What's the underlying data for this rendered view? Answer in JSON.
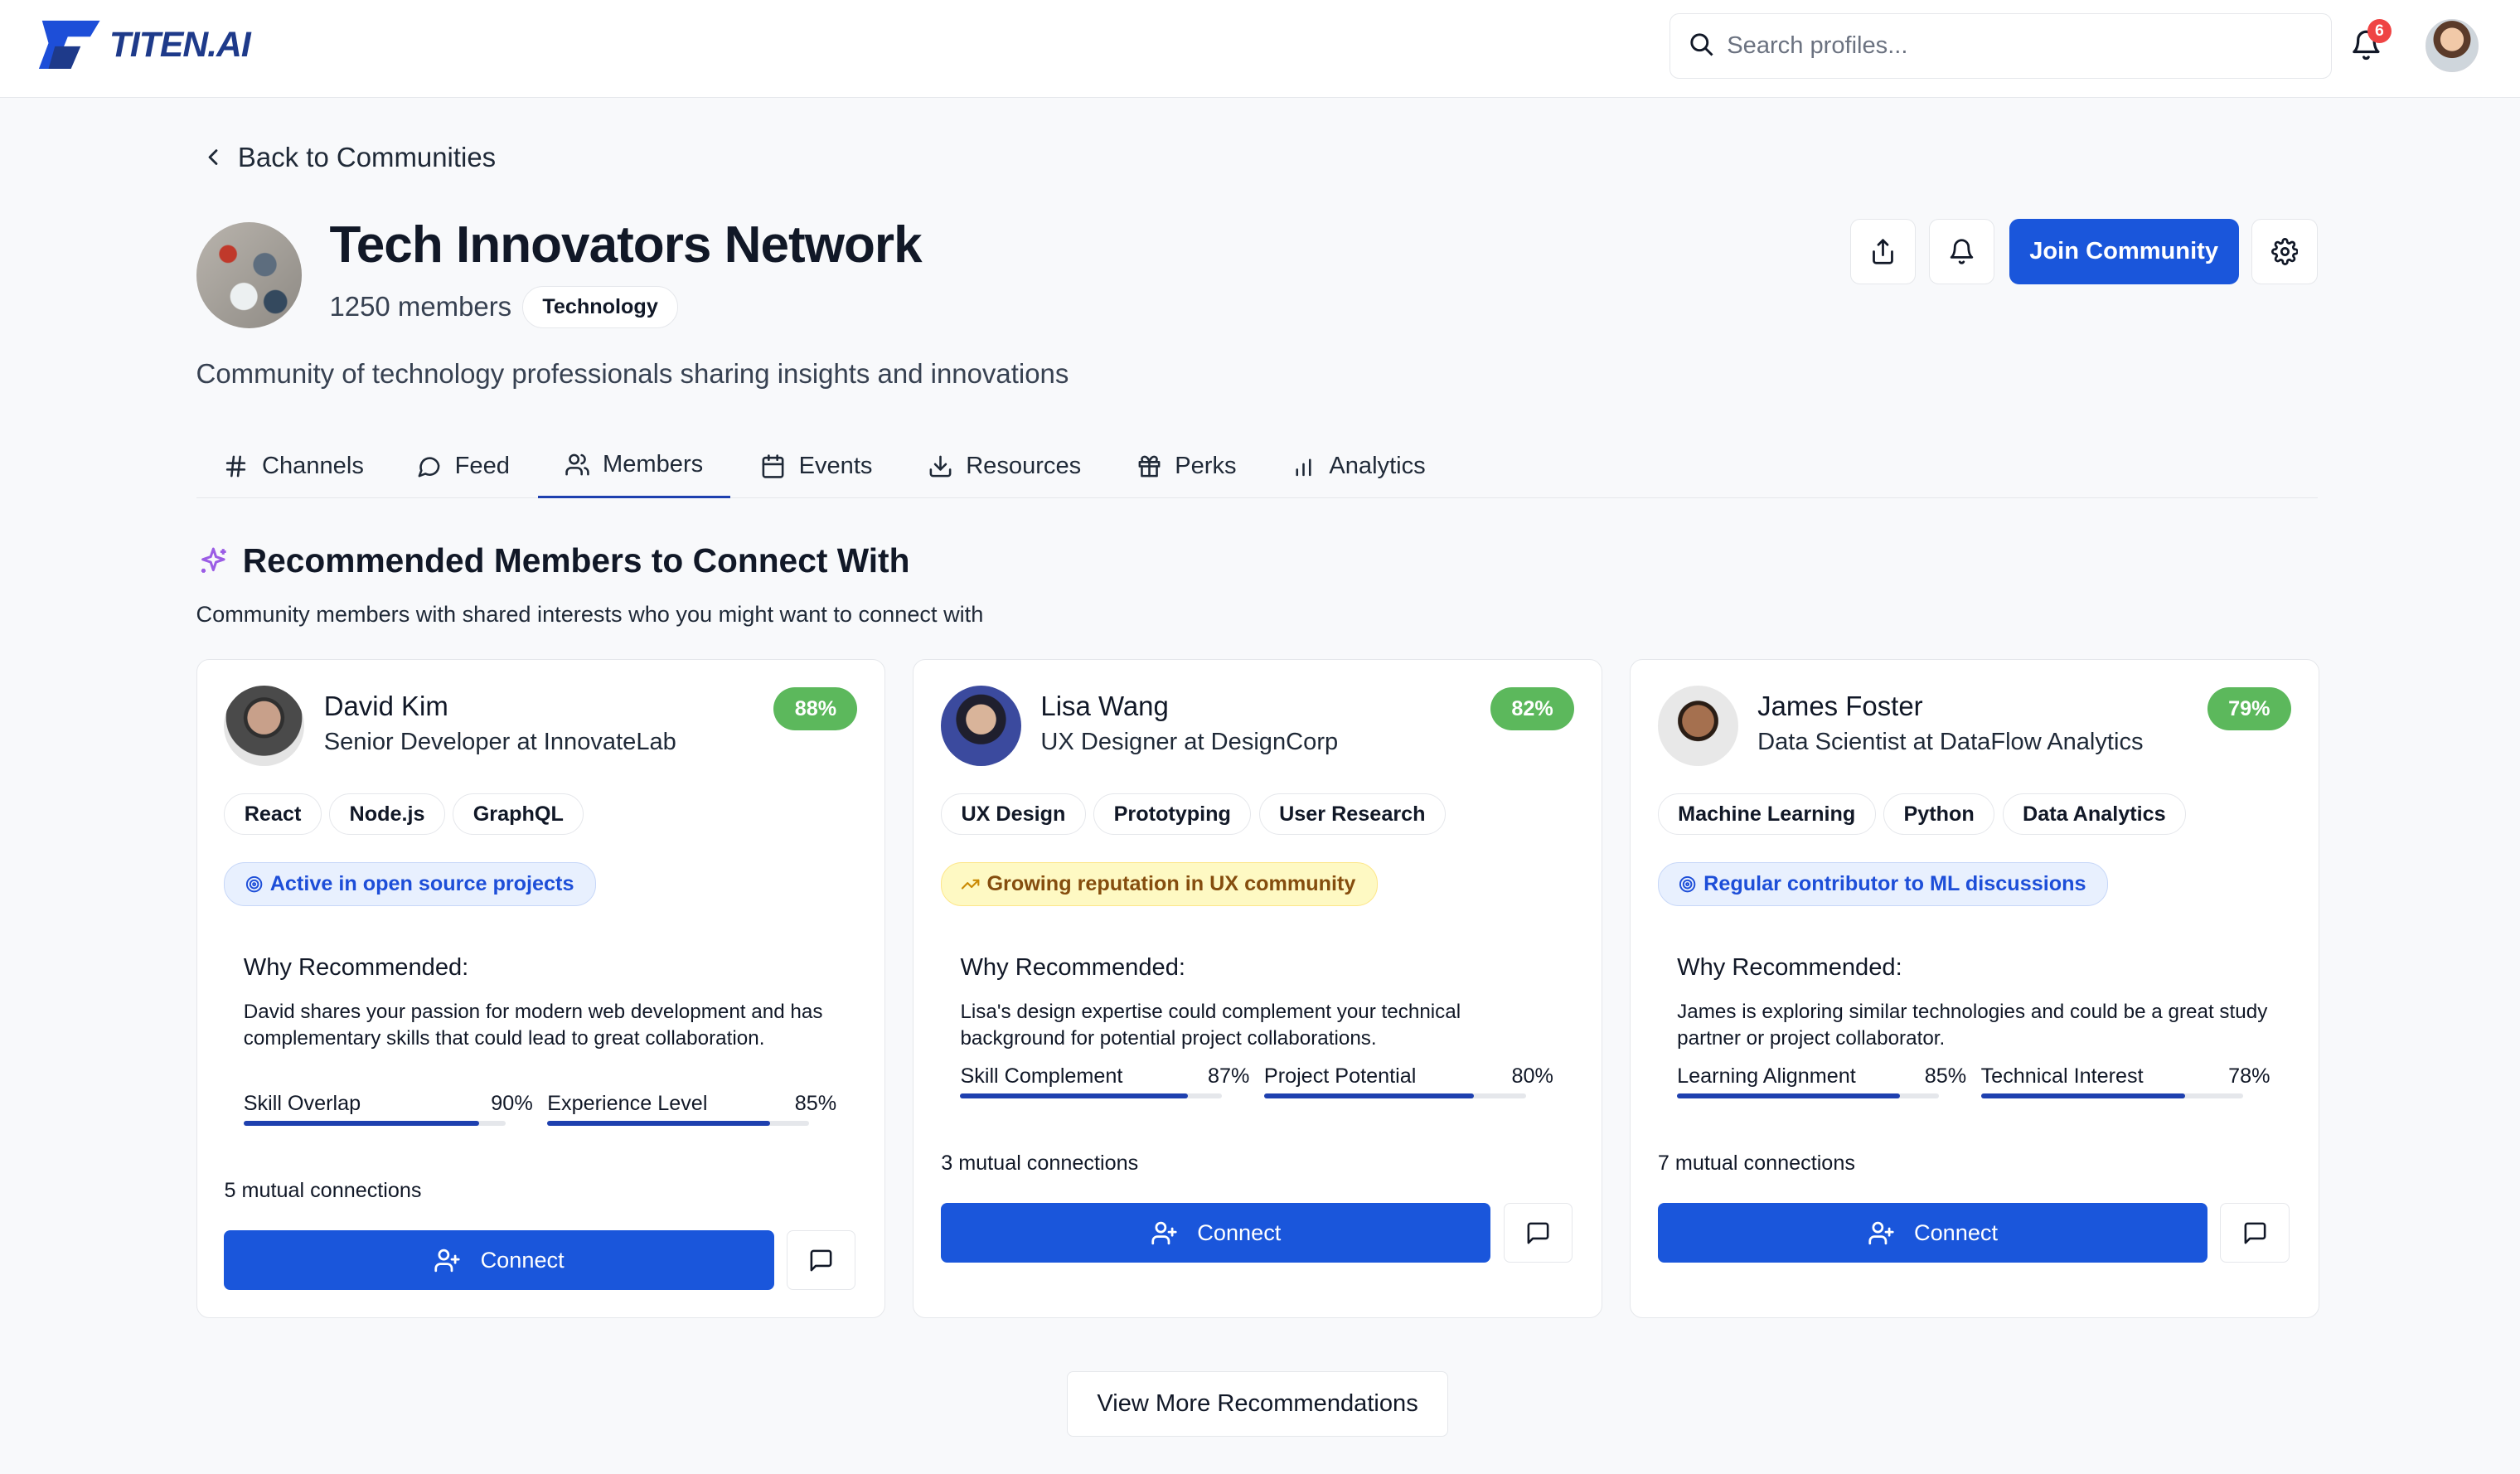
{
  "header": {
    "logo_text": "TITEN.AI",
    "search_placeholder": "Search profiles...",
    "notification_count": "6"
  },
  "community": {
    "back_label": "Back to Communities",
    "name": "Tech Innovators Network",
    "members": "1250 members",
    "category": "Technology",
    "description": "Community of technology professionals sharing insights and innovations",
    "join_label": "Join Community"
  },
  "tabs": [
    {
      "label": "Channels",
      "icon": "hash-icon"
    },
    {
      "label": "Feed",
      "icon": "chat-bubble-icon"
    },
    {
      "label": "Members",
      "icon": "users-icon",
      "active": true
    },
    {
      "label": "Events",
      "icon": "calendar-icon"
    },
    {
      "label": "Resources",
      "icon": "download-icon"
    },
    {
      "label": "Perks",
      "icon": "gift-icon"
    },
    {
      "label": "Analytics",
      "icon": "bar-chart-icon"
    }
  ],
  "section": {
    "title": "Recommended Members to Connect With",
    "subtitle": "Community members with shared interests who you might want to connect with"
  },
  "why_label": "Why Recommended:",
  "connect_label": "Connect",
  "view_more_label": "View More Recommendations",
  "members": [
    {
      "name": "David Kim",
      "role": "Senior Developer at InnovateLab",
      "match": "88%",
      "skills": [
        "React",
        "Node.js",
        "GraphQL"
      ],
      "highlight": "Active in open source projects",
      "highlight_style": "blue",
      "why": "David shares your passion for modern web development and has complementary skills that could lead to great collaboration.",
      "metrics": [
        {
          "label": "Skill Overlap",
          "value": "90%",
          "fill": 0.9
        },
        {
          "label": "Experience Level",
          "value": "85%",
          "fill": 0.85
        }
      ],
      "mutual": "5 mutual connections"
    },
    {
      "name": "Lisa Wang",
      "role": "UX Designer at DesignCorp",
      "match": "82%",
      "skills": [
        "UX Design",
        "Prototyping",
        "User Research"
      ],
      "highlight": "Growing reputation in UX community",
      "highlight_style": "yellow",
      "why": "Lisa's design expertise could complement your technical background for potential project collaborations.",
      "metrics": [
        {
          "label": "Skill Complement",
          "value": "87%",
          "fill": 0.87
        },
        {
          "label": "Project Potential",
          "value": "80%",
          "fill": 0.8
        }
      ],
      "mutual": "3 mutual connections"
    },
    {
      "name": "James Foster",
      "role": "Data Scientist at DataFlow Analytics",
      "match": "79%",
      "skills": [
        "Machine Learning",
        "Python",
        "Data Analytics"
      ],
      "highlight": "Regular contributor to ML discussions",
      "highlight_style": "blue",
      "why": "James is exploring similar technologies and could be a great study partner or project collaborator.",
      "metrics": [
        {
          "label": "Learning Alignment",
          "value": "85%",
          "fill": 0.85
        },
        {
          "label": "Technical Interest",
          "value": "78%",
          "fill": 0.78
        }
      ],
      "mutual": "7 mutual connections"
    }
  ]
}
